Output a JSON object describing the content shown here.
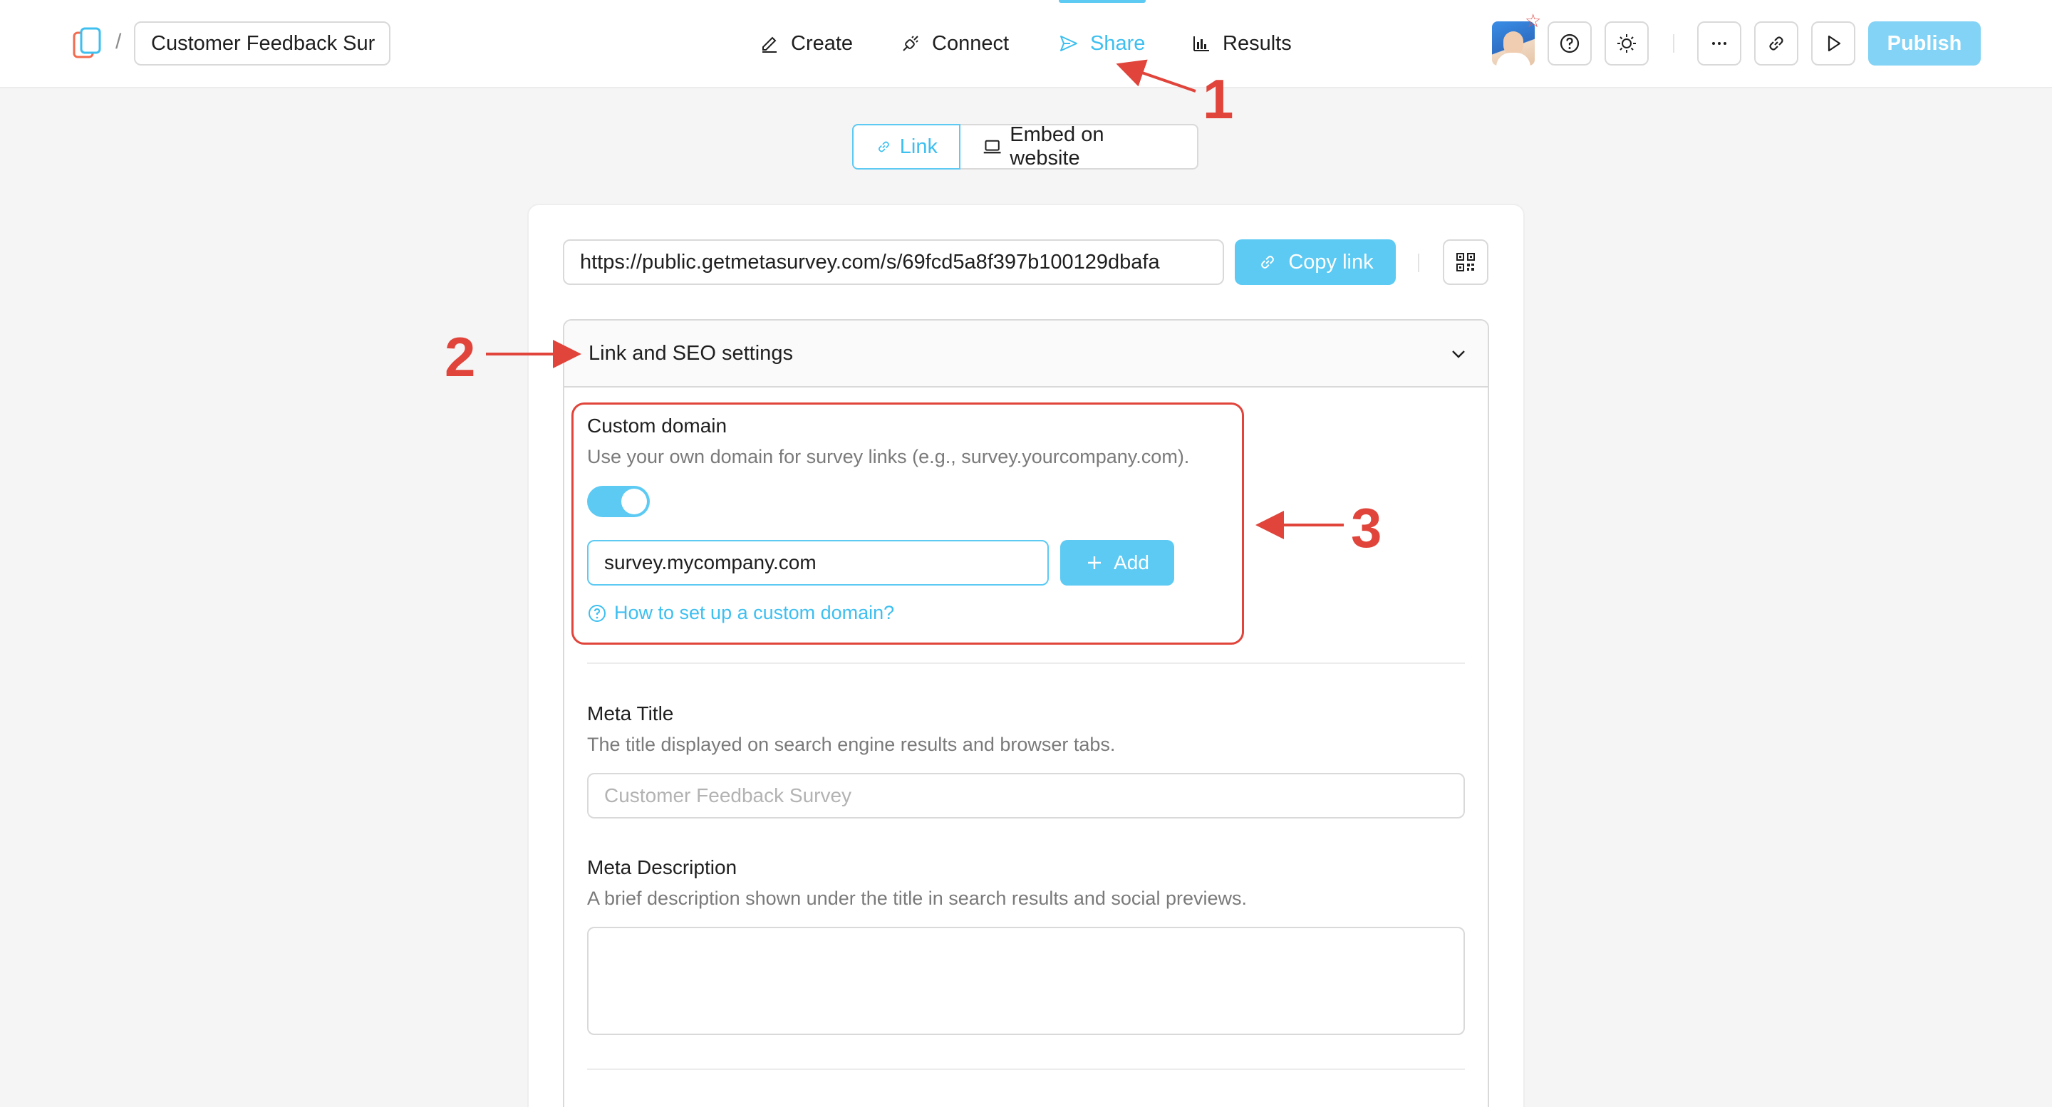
{
  "header": {
    "breadcrumb_separator": "/",
    "survey_title": "Customer Feedback Sur",
    "nav": [
      {
        "label": "Create",
        "icon": "pencil-icon",
        "active": false
      },
      {
        "label": "Connect",
        "icon": "plug-icon",
        "active": false
      },
      {
        "label": "Share",
        "icon": "send-icon",
        "active": true
      },
      {
        "label": "Results",
        "icon": "bar-chart-icon",
        "active": false
      }
    ],
    "publish_label": "Publish"
  },
  "share_tabs": {
    "link_label": "Link",
    "embed_label": "Embed on website"
  },
  "link": {
    "url": "https://public.getmetasurvey.com/s/69fcd5a8f397b100129dbafa",
    "copy_label": "Copy link"
  },
  "seo_panel": {
    "title": "Link and SEO settings",
    "custom_domain": {
      "label": "Custom domain",
      "description": "Use your own domain for survey links (e.g., survey.yourcompany.com).",
      "enabled": true,
      "value": "survey.mycompany.com",
      "add_label": "Add",
      "help_link": "How to set up a custom domain?"
    },
    "meta_title": {
      "label": "Meta Title",
      "description": "The title displayed on search engine results and browser tabs.",
      "placeholder": "Customer Feedback Survey"
    },
    "meta_description": {
      "label": "Meta Description",
      "description": "A brief description shown under the title in search results and social previews.",
      "value": ""
    }
  },
  "annotations": {
    "one": "1",
    "two": "2",
    "three": "3",
    "color": "#e0443a"
  },
  "colors": {
    "accent": "#5ccaf3",
    "accent_text": "#3dbff0",
    "publish_bg": "#82d3f5"
  }
}
